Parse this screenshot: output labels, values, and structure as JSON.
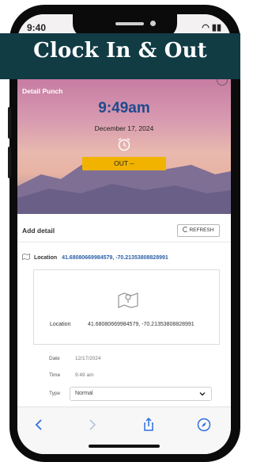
{
  "status_bar": {
    "time": "9:40",
    "right": "◠ ▮▮"
  },
  "banner": {
    "title": "Clock In & Out"
  },
  "hero": {
    "label": "Detail Punch",
    "time": "9:49am",
    "date": "December 17, 2024",
    "out_button": "OUT --"
  },
  "detail": {
    "title": "Add detail",
    "refresh_label": "REFRESH",
    "location_label": "Location",
    "location_value": "41.68080669984579, -70.21353808828991",
    "map_location_label": "Location",
    "map_location_value": "41.68080669984579, -70.21353808828991",
    "date_label": "Date",
    "date_value": "12/17/2024",
    "time_label": "Time",
    "time_value": "9:49 am",
    "type_label": "Type",
    "type_value": "Normal"
  },
  "icons": {
    "alarm": "alarm-clock-icon",
    "refresh": "refresh-icon",
    "location": "map-icon",
    "back": "chevron-left-icon",
    "forward": "chevron-right-icon",
    "share": "share-icon",
    "compass": "compass-icon"
  },
  "colors": {
    "banner": "#113c44",
    "accent_blue": "#1d4a8f",
    "out_button": "#f1b200",
    "link_blue": "#2a5ea8"
  }
}
